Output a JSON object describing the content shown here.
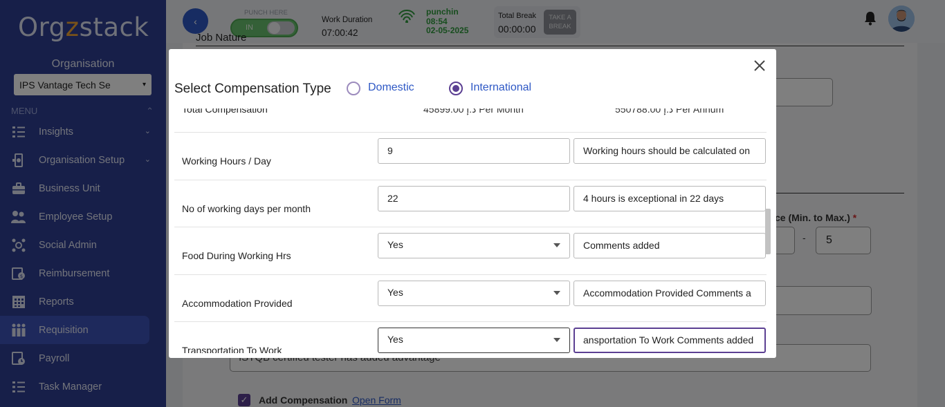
{
  "sidebar": {
    "logo_pre": "Org",
    "logo_z": "z",
    "logo_post": "stack",
    "org_label": "Organisation",
    "org_selected": "IPS Vantage Tech Se",
    "menu_heading": "MENU",
    "items": [
      {
        "label": "Insights",
        "icon": "insights-icon",
        "chevron": true
      },
      {
        "label": "Organisation Setup",
        "icon": "organisation-setup-icon",
        "chevron": true
      },
      {
        "label": "Business Unit",
        "icon": "briefcase-icon",
        "chevron": false
      },
      {
        "label": "Employee Setup",
        "icon": "employees-icon",
        "chevron": false
      },
      {
        "label": "Social Admin",
        "icon": "social-icon",
        "chevron": false
      },
      {
        "label": "Reimbursement",
        "icon": "reimbursement-icon",
        "chevron": false
      },
      {
        "label": "Reports",
        "icon": "reports-icon",
        "chevron": false
      },
      {
        "label": "Requisition",
        "icon": "requisition-icon",
        "chevron": false,
        "active": true
      },
      {
        "label": "Payroll",
        "icon": "payroll-icon",
        "chevron": false
      },
      {
        "label": "Task Manager",
        "icon": "task-manager-icon",
        "chevron": false
      }
    ]
  },
  "topbar": {
    "punch_label": "PUNCH HERE",
    "toggle_text": "IN",
    "work_duration_label": "Work Duration",
    "work_duration_value": "07:00:42",
    "punch_status": "punchin",
    "punch_time": "08:54",
    "punch_date": "02-05-2025",
    "total_break_label": "Total Break",
    "total_break_value": "00:00:00",
    "take_break_line1": "TAKE A",
    "take_break_line2": "BREAK"
  },
  "background": {
    "heading_fragment": "Job Nature",
    "range_label": "ce (Min. to Max.)",
    "range_required": "*",
    "range_dash": "-",
    "range_max": "5",
    "skills_text": "ISTQB certified tester has added advantage",
    "add_compensation_label": "Add Compensation",
    "open_form_link": "Open Form"
  },
  "modal": {
    "title": "Select Compensation Type",
    "option_domestic": "Domestic",
    "option_international": "International",
    "selected": "International",
    "total_row": {
      "label": "Total Compensation",
      "monthly": "45899.00 ﺩ.ﺇ Per Month",
      "annual": "550788.00 ﺩ.ﺇ Per Annum"
    },
    "rows": [
      {
        "label": "Working Hours / Day",
        "value": "9",
        "type": "input",
        "comment": "Working hours should be calculated on"
      },
      {
        "label": "No of working days per month",
        "value": "22",
        "type": "input",
        "comment": "4 hours is exceptional in 22 days"
      },
      {
        "label": "Food During Working Hrs",
        "value": "Yes",
        "type": "select",
        "comment": "Comments added"
      },
      {
        "label": "Accommodation Provided",
        "value": "Yes",
        "type": "select",
        "comment": "Accommodation Provided Comments a"
      },
      {
        "label": "Transportation To Work",
        "value": "Yes",
        "type": "select",
        "comment": "ansportation To Work Comments added"
      }
    ]
  },
  "colors": {
    "sidebar_bg": "#2e3f93",
    "accent_purple": "#5b3f92",
    "link_blue": "#2e58c5",
    "punch_green": "#2f9a3c"
  }
}
